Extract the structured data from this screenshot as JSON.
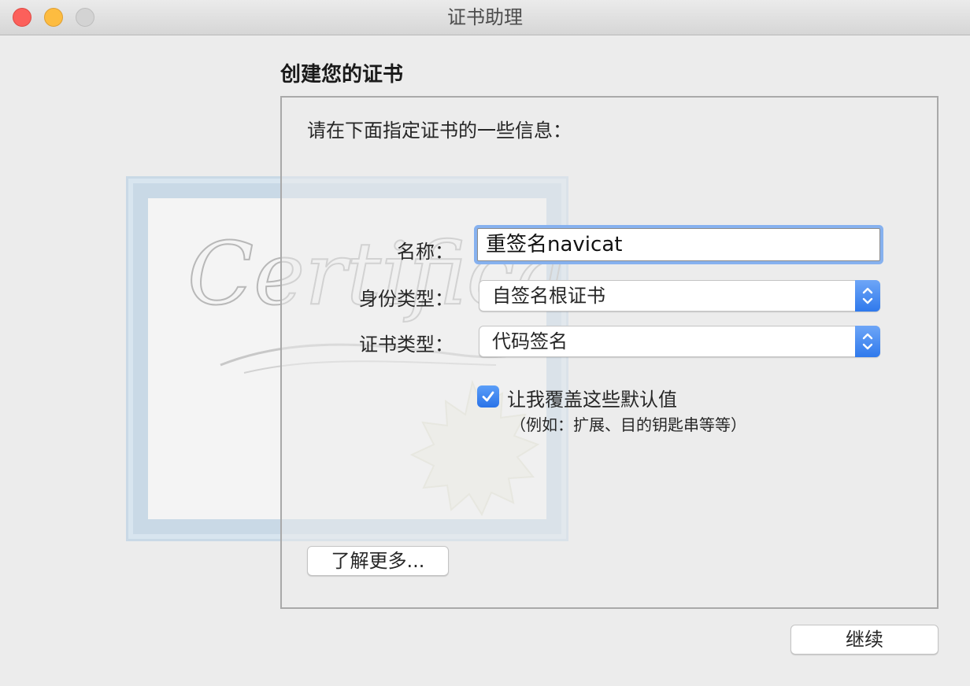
{
  "window": {
    "title": "证书助理"
  },
  "page": {
    "heading": "创建您的证书",
    "instructions": "请在下面指定证书的一些信息："
  },
  "illustration": {
    "watermark_text": "Certificate"
  },
  "form": {
    "name_label": "名称：",
    "name_value": "重签名navicat",
    "identity_type_label": "身份类型：",
    "identity_type_value": "自签名根证书",
    "certificate_type_label": "证书类型：",
    "certificate_type_value": "代码签名",
    "override_defaults_label": "让我覆盖这些默认值",
    "override_defaults_checked": true,
    "override_defaults_hint": "（例如：扩展、目的钥匙串等等）"
  },
  "buttons": {
    "learn_more": "了解更多...",
    "continue": "继续"
  },
  "colors": {
    "accent": "#2f79ec",
    "focus_ring": "#86b1ef",
    "close": "#fc605b",
    "minimize": "#fdbc40",
    "zoom": "#d3d3d3"
  }
}
